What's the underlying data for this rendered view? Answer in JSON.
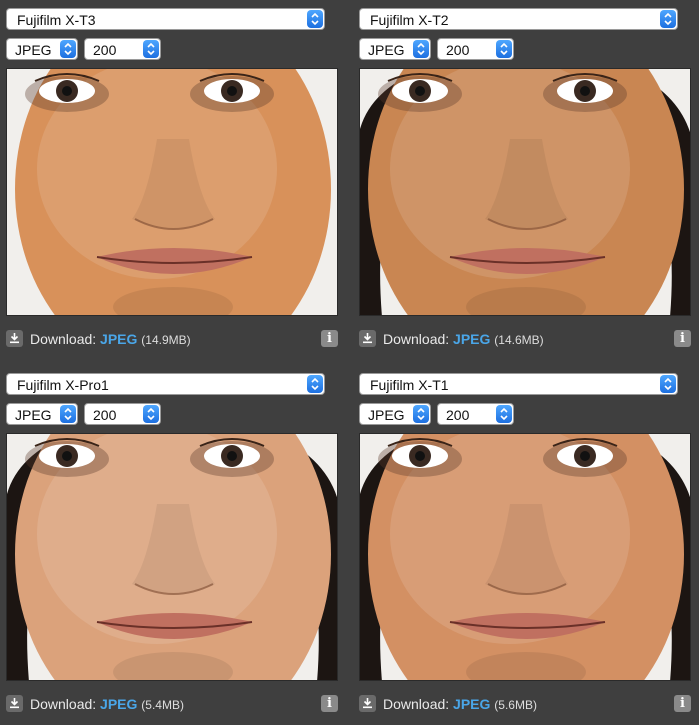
{
  "panels": [
    {
      "camera": "Fujifilm X-T3",
      "format": "JPEG",
      "iso": "200",
      "download_label": "Download:",
      "download_format": "JPEG",
      "file_size": "(14.9MB)",
      "skin": "#d8915a",
      "hair": false
    },
    {
      "camera": "Fujifilm X-T2",
      "format": "JPEG",
      "iso": "200",
      "download_label": "Download:",
      "download_format": "JPEG",
      "file_size": "(14.6MB)",
      "skin": "#c98652",
      "hair": true
    },
    {
      "camera": "Fujifilm X-Pro1",
      "format": "JPEG",
      "iso": "200",
      "download_label": "Download:",
      "download_format": "JPEG",
      "file_size": "(5.4MB)",
      "skin": "#dba27b",
      "hair": true
    },
    {
      "camera": "Fujifilm X-T1",
      "format": "JPEG",
      "iso": "200",
      "download_label": "Download:",
      "download_format": "JPEG",
      "file_size": "(5.6MB)",
      "skin": "#d39063",
      "hair": true
    }
  ],
  "colors": {
    "background": "#3f3f3f",
    "link": "#4aa6e8",
    "select_arrow": "#1d6fe0"
  },
  "icons": {
    "download": "download-icon",
    "info": "info-icon",
    "select": "select-arrows-icon"
  }
}
